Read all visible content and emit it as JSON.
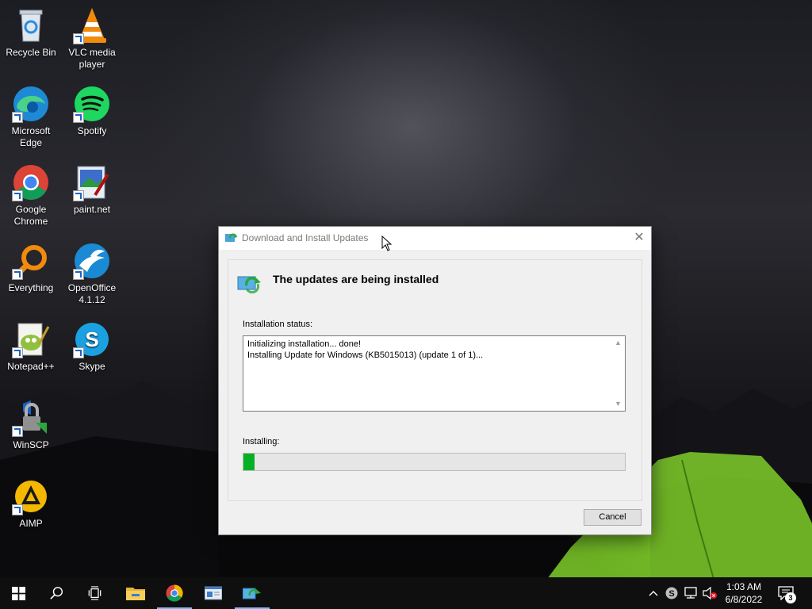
{
  "desktop": {
    "icons": [
      {
        "label": "Recycle Bin",
        "icon": "recycle-bin-icon"
      },
      {
        "label": "VLC media player",
        "icon": "vlc-icon"
      },
      {
        "label": "Microsoft Edge",
        "icon": "edge-icon"
      },
      {
        "label": "Spotify",
        "icon": "spotify-icon"
      },
      {
        "label": "Google Chrome",
        "icon": "chrome-icon"
      },
      {
        "label": "paint.net",
        "icon": "paintnet-icon"
      },
      {
        "label": "Everything",
        "icon": "everything-icon"
      },
      {
        "label": "OpenOffice 4.1.12",
        "icon": "openoffice-icon"
      },
      {
        "label": "Notepad++",
        "icon": "notepadpp-icon"
      },
      {
        "label": "Skype",
        "icon": "skype-icon"
      },
      {
        "label": "WinSCP",
        "icon": "winscp-icon"
      },
      {
        "label": "AIMP",
        "icon": "aimp-icon"
      }
    ]
  },
  "dialog": {
    "title": "Download and Install Updates",
    "heading": "The updates are being installed",
    "status_label": "Installation status:",
    "status_lines": [
      "Initializing installation... done!",
      "Installing Update for Windows (KB5015013) (update 1 of 1)..."
    ],
    "progress_label": "Installing:",
    "progress_fraction": 0.03,
    "cancel_label": "Cancel",
    "accent_color": "#06b025"
  },
  "taskbar": {
    "items": [
      "start",
      "search",
      "task-view",
      "file-explorer",
      "chrome",
      "windows-update-window",
      "download-install-updates"
    ],
    "clock_time": "1:03 AM",
    "clock_date": "6/8/2022",
    "notification_count": "3"
  }
}
